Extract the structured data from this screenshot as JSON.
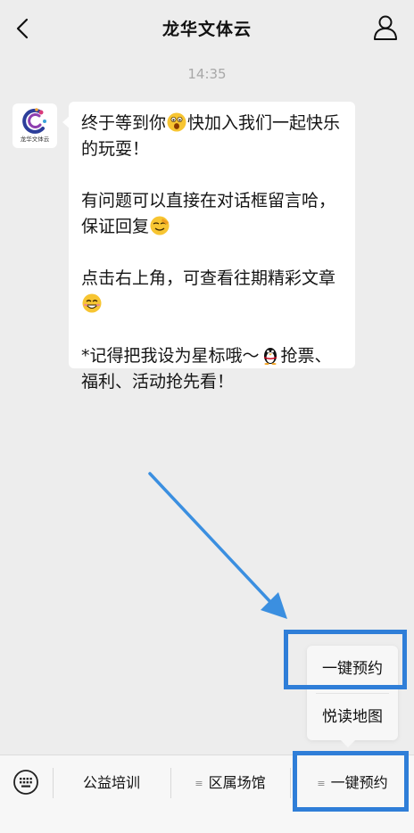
{
  "header": {
    "title": "龙华文体云",
    "back_icon": "chevron-left-icon",
    "profile_icon": "person-icon"
  },
  "chat": {
    "time": "14:35",
    "avatar": {
      "logo_icon": "longhua-logo-icon",
      "text": "龙华文体云"
    },
    "message": {
      "p1": {
        "before": "终于等到你",
        "emoji": "surprised-face-emoji",
        "after": "快加入我们一起快乐的玩耍！"
      },
      "p2": {
        "before": "有问题可以直接在对话框留言哈，保证回复",
        "emoji": "salute-face-emoji"
      },
      "p3": {
        "before": "点击右上角，可查看往期精彩文章",
        "emoji": "grin-face-emoji"
      },
      "p4": {
        "before": "*记得把我设为星标哦～",
        "emoji": "penguin-emoji",
        "after": "抢票、福利、活动抢先看！"
      }
    }
  },
  "submenu": {
    "items": [
      "一键预约",
      "悦读地图"
    ]
  },
  "bottom_menu": {
    "keyboard_icon": "keyboard-icon",
    "items": [
      "公益培训",
      "区属场馆",
      "一键预约"
    ]
  },
  "colors": {
    "highlight": "#2f7ed8",
    "background": "#ededed"
  }
}
